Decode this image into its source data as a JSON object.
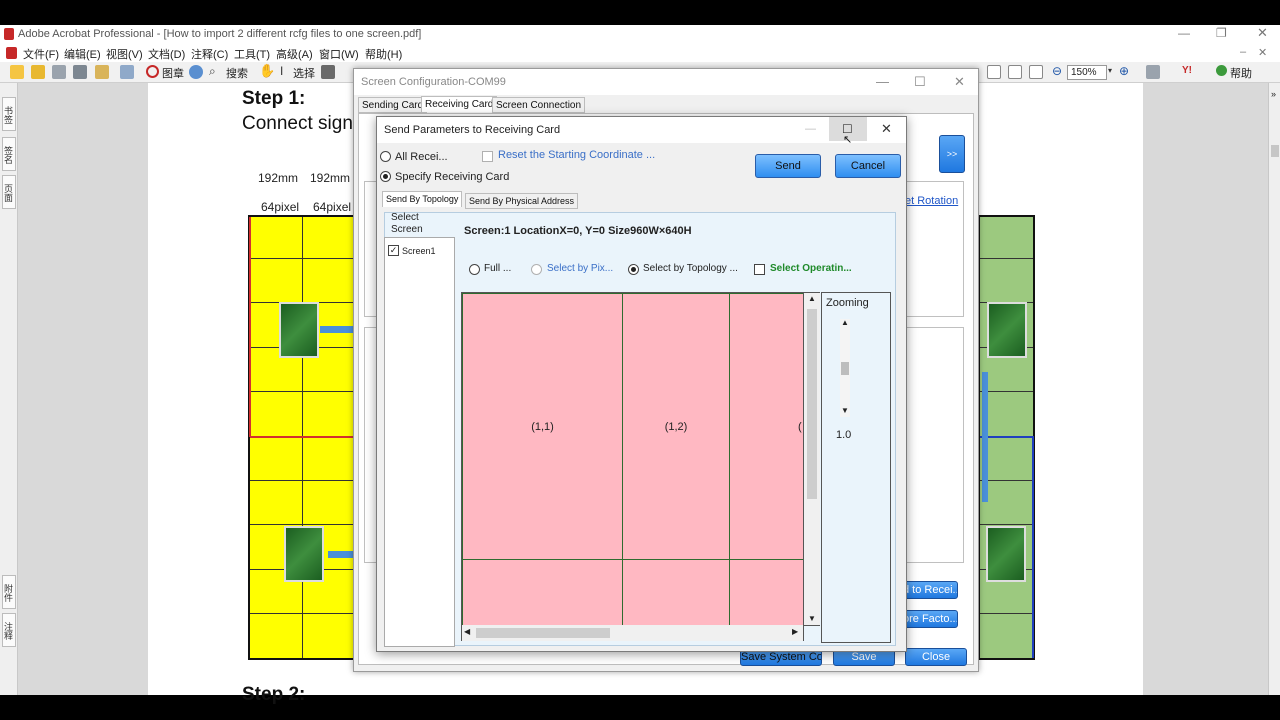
{
  "acrobat": {
    "title": "Adobe Acrobat Professional - [How to import 2 different rcfg files to one screen.pdf]",
    "menu": [
      "文件(F)",
      "编辑(E)",
      "视图(V)",
      "文档(D)",
      "注释(C)",
      "工具(T)",
      "高级(A)",
      "窗口(W)",
      "帮助(H)"
    ],
    "toolbar": {
      "stamp": "图章",
      "search": "搜索",
      "select": "选择",
      "zoom": "150%",
      "help": "帮助"
    },
    "left_tabs": [
      "书签",
      "签名",
      "页面",
      "附件",
      "注释"
    ]
  },
  "pdf": {
    "step1": "Step 1:",
    "connect": "Connect sign",
    "step2": "Step 2:",
    "dims_mm": [
      "192mm",
      "192mm"
    ],
    "dims_px": [
      "64pixel",
      "64pixel"
    ]
  },
  "config": {
    "title": "Screen Configuration-COM99",
    "tabs": [
      "Sending Card",
      "Receiving Card",
      "Screen Connection"
    ],
    "expand_button": ">>",
    "set_rotation": "et Rotation",
    "send_to_receiving": "d to Recei...",
    "restore_factory": "ore Facto...",
    "save_system": "Save System Co...",
    "save": "Save",
    "close": "Close"
  },
  "dialog": {
    "title": "Send Parameters to Receiving Card",
    "all_receiving": "All Recei...",
    "reset_start": "Reset the Starting Coordinate ...",
    "specify_card": "Specify Receiving Card",
    "send": "Send",
    "cancel": "Cancel",
    "tab_topology": "Send By Topology",
    "tab_physical": "Send By Physical Address",
    "select_screen": "Select Screen",
    "screen_item": "Screen1",
    "screen_info": "Screen:1  LocationX=0, Y=0   Size960W×640H",
    "opt_full": "Full ...",
    "opt_pixel": "Select by Pix...",
    "opt_topology": "Select by Topology ...",
    "opt_operating": "Select Operatin...",
    "cells": [
      "(1,1)",
      "(1,2)",
      "("
    ],
    "zoom_label": "Zooming",
    "zoom_value": "1.0"
  }
}
